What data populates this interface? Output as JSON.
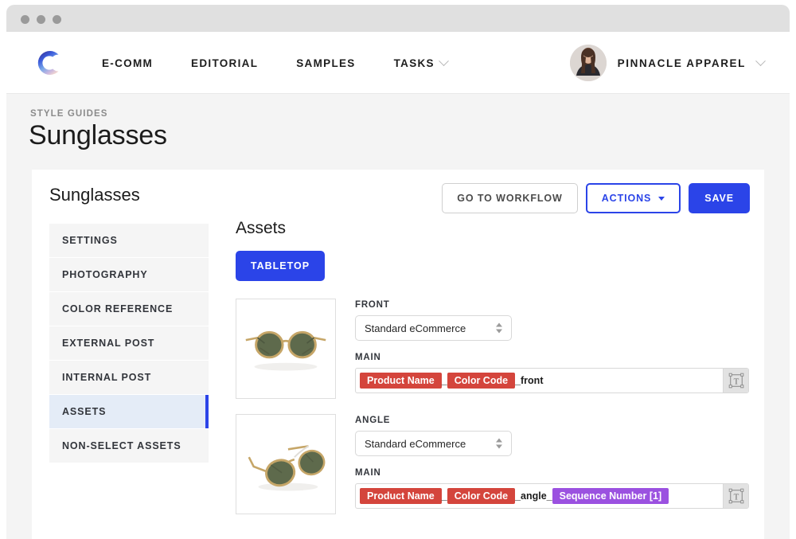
{
  "window": {
    "traffic_lights": [
      "close",
      "minimize",
      "maximize"
    ]
  },
  "header": {
    "logo_alt": "brand-logo-c",
    "nav": [
      {
        "label": "E-COMM",
        "has_dropdown": false
      },
      {
        "label": "EDITORIAL",
        "has_dropdown": false
      },
      {
        "label": "SAMPLES",
        "has_dropdown": false
      },
      {
        "label": "TASKS",
        "has_dropdown": true
      }
    ],
    "account": {
      "name": "PINNACLE APPAREL",
      "avatar_alt": "user-avatar",
      "has_dropdown": true
    }
  },
  "page": {
    "breadcrumb": "STYLE GUIDES",
    "title": "Sunglasses"
  },
  "card": {
    "title": "Sunglasses",
    "buttons": {
      "workflow": "GO TO WORKFLOW",
      "actions": "ACTIONS",
      "save": "SAVE"
    }
  },
  "sidebar": {
    "items": [
      {
        "label": "SETTINGS",
        "active": false
      },
      {
        "label": "PHOTOGRAPHY",
        "active": false
      },
      {
        "label": "COLOR REFERENCE",
        "active": false
      },
      {
        "label": "EXTERNAL POST",
        "active": false
      },
      {
        "label": "INTERNAL POST",
        "active": false
      },
      {
        "label": "ASSETS",
        "active": true
      },
      {
        "label": "NON-SELECT ASSETS",
        "active": false
      }
    ]
  },
  "main": {
    "heading": "Assets",
    "tab": "TABLETOP",
    "assets": [
      {
        "thumb_alt": "sunglasses-front-thumbnail",
        "view_label": "FRONT",
        "preset": "Standard eCommerce",
        "naming_label": "MAIN",
        "tokens": [
          {
            "type": "tag",
            "color": "red",
            "text": "Product Name"
          },
          {
            "type": "text",
            "text": "_"
          },
          {
            "type": "tag",
            "color": "red",
            "text": "Color Code"
          },
          {
            "type": "text",
            "text": "_front"
          }
        ],
        "tool_icon": "text-box-icon"
      },
      {
        "thumb_alt": "sunglasses-angle-thumbnail",
        "view_label": "ANGLE",
        "preset": "Standard eCommerce",
        "naming_label": "MAIN",
        "tokens": [
          {
            "type": "tag",
            "color": "red",
            "text": "Product Name"
          },
          {
            "type": "text",
            "text": "_"
          },
          {
            "type": "tag",
            "color": "red",
            "text": "Color Code"
          },
          {
            "type": "text",
            "text": "_angle_"
          },
          {
            "type": "tag",
            "color": "purple",
            "text": "Sequence Number [1]"
          }
        ],
        "tool_icon": "text-box-icon"
      }
    ]
  },
  "colors": {
    "accent_blue": "#2b44e8",
    "tag_red": "#d4453c",
    "tag_purple": "#9b51e0",
    "active_item_bg": "#e4ecf7",
    "page_bg": "#f4f4f4"
  }
}
